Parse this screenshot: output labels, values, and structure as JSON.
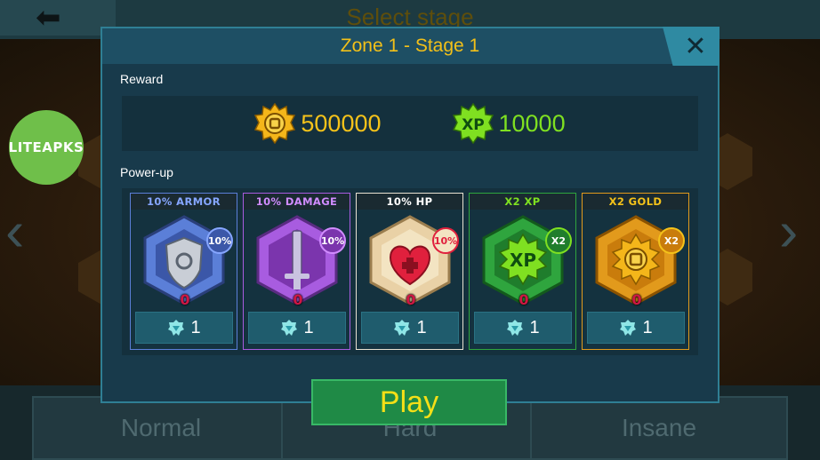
{
  "background": {
    "title": "Select stage",
    "difficulties": [
      "Normal",
      "Hard",
      "Insane"
    ]
  },
  "watermark": "LITEAPKS",
  "dialog": {
    "title": "Zone 1 - Stage 1",
    "close_icon": "close-icon",
    "reward_label": "Reward",
    "rewards": {
      "gold": {
        "icon": "gold-coin-icon",
        "value": "500000"
      },
      "xp": {
        "icon": "xp-badge-icon",
        "value": "10000"
      }
    },
    "powerup_label": "Power-up",
    "powerups": [
      {
        "title": "10% ARMOR",
        "badge": "10%",
        "count": "0",
        "cost": "1",
        "icon": "shield-icon",
        "color": "#5b7fd8"
      },
      {
        "title": "10% DAMAGE",
        "badge": "10%",
        "count": "0",
        "cost": "1",
        "icon": "sword-icon",
        "color": "#a85ce0"
      },
      {
        "title": "10% HP",
        "badge": "10%",
        "count": "0",
        "cost": "1",
        "icon": "heart-icon",
        "color": "#e9d1a6"
      },
      {
        "title": "X2 XP",
        "badge": "X2",
        "count": "0",
        "cost": "1",
        "icon": "xp-boost-icon",
        "color": "#2fa53e"
      },
      {
        "title": "X2 GOLD",
        "badge": "X2",
        "count": "0",
        "cost": "1",
        "icon": "gold-boost-icon",
        "color": "#e29a1c"
      }
    ],
    "play_label": "Play"
  }
}
